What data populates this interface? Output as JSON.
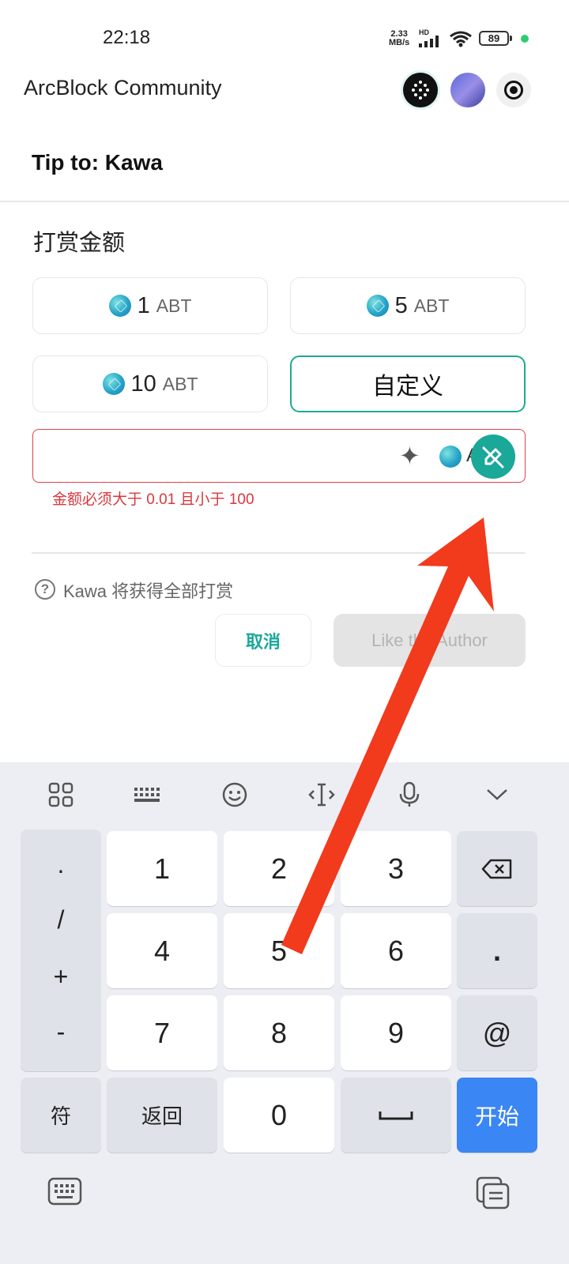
{
  "status_bar": {
    "time": "22:18",
    "net_speed_value": "2.33",
    "net_speed_unit": "MB/s",
    "hd": "HD",
    "battery": "89"
  },
  "app": {
    "title": "ArcBlock Community"
  },
  "dialog": {
    "title": "Tip to: Kawa",
    "amount_label": "打赏金额",
    "options": [
      {
        "value": "1",
        "unit": "ABT"
      },
      {
        "value": "5",
        "unit": "ABT"
      },
      {
        "value": "10",
        "unit": "ABT"
      },
      {
        "value": "自定义",
        "unit": ""
      }
    ],
    "input": {
      "value": "",
      "suffix": "A"
    },
    "error": "金额必须大于 0.01 且小于 100",
    "help_text": "Kawa 将获得全部打赏",
    "cancel_label": "取消",
    "confirm_label": "Like the Author"
  },
  "keyboard": {
    "symbols": [
      ".",
      "/",
      "+",
      "-"
    ],
    "keys": [
      [
        "1",
        "2",
        "3"
      ],
      [
        "4",
        "5",
        "6"
      ],
      [
        "7",
        "8",
        "9"
      ]
    ],
    "right_keys": [
      ".",
      "@"
    ],
    "sym_label": "符",
    "back_label": "返回",
    "zero": "0",
    "enter_label": "开始"
  },
  "colors": {
    "accent": "#1aa899",
    "error": "#d8383f",
    "enter": "#3a86f4",
    "arrow": "#f23a1d"
  }
}
